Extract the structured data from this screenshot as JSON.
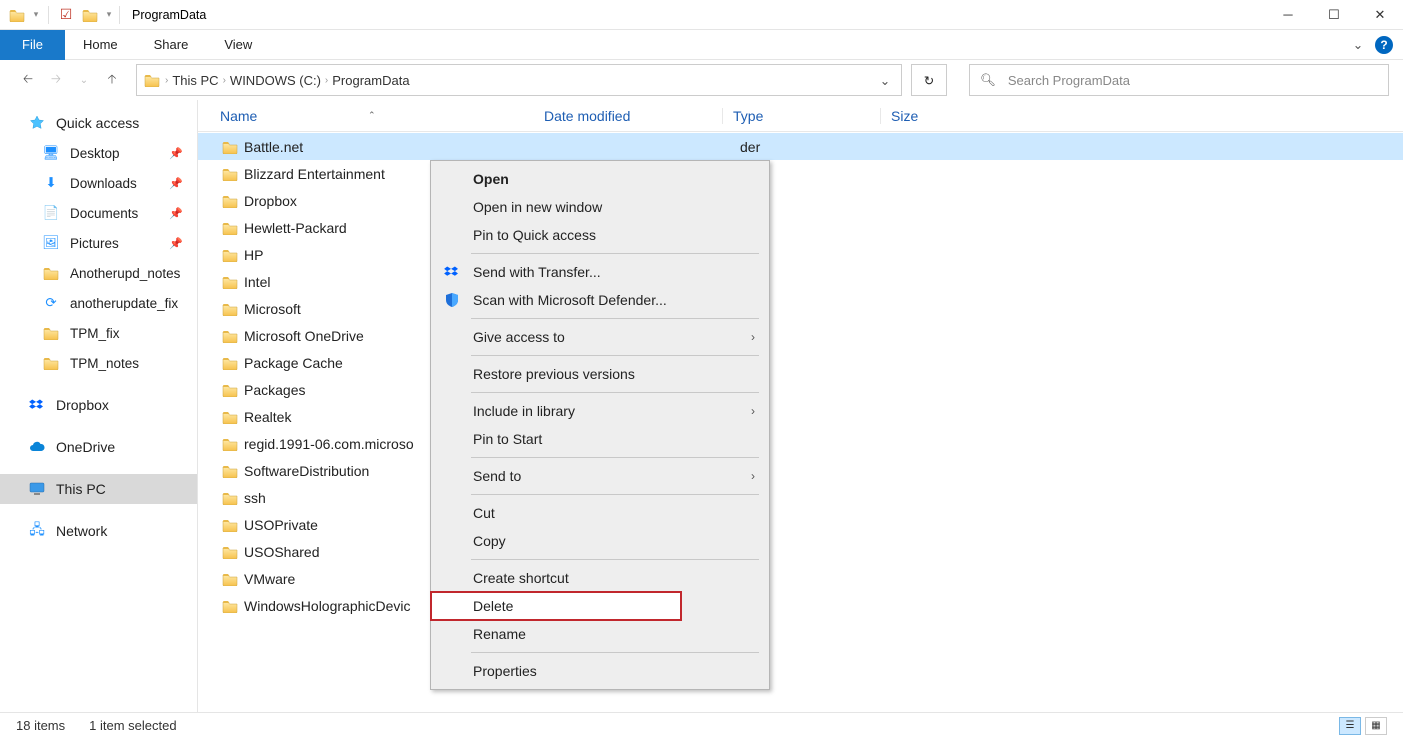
{
  "titlebar": {
    "title": "ProgramData"
  },
  "ribbon": {
    "tabs": {
      "file": "File",
      "home": "Home",
      "share": "Share",
      "view": "View"
    }
  },
  "breadcrumbs": {
    "pc": "This PC",
    "drive": "WINDOWS (C:)",
    "folder": "ProgramData"
  },
  "search": {
    "placeholder": "Search ProgramData"
  },
  "sidebar": {
    "quick": "Quick access",
    "desktop": "Desktop",
    "downloads": "Downloads",
    "documents": "Documents",
    "pictures": "Pictures",
    "anotherupd": "Anotherupd_notes",
    "anotherfix": "anotherupdate_fix",
    "tpmfix": "TPM_fix",
    "tpmnotes": "TPM_notes",
    "dropbox": "Dropbox",
    "onedrive": "OneDrive",
    "thispc": "This PC",
    "network": "Network"
  },
  "columns": {
    "name": "Name",
    "date": "Date modified",
    "type": "Type",
    "size": "Size"
  },
  "type_suffix": "der",
  "rows": {
    "battle": "Battle.net",
    "blizzard": "Blizzard Entertainment",
    "dropbox": "Dropbox",
    "hp1": "Hewlett-Packard",
    "hp2": "HP",
    "intel": "Intel",
    "ms": "Microsoft",
    "od": "Microsoft OneDrive",
    "pkgc": "Package Cache",
    "pkgs": "Packages",
    "realtek": "Realtek",
    "regid": "regid.1991-06.com.microso",
    "softd": "SoftwareDistribution",
    "ssh": "ssh",
    "usop": "USOPrivate",
    "usos": "USOShared",
    "vmw": "VMware",
    "whd": "WindowsHolographicDevic"
  },
  "ctx": {
    "open": "Open",
    "opennew": "Open in new window",
    "pinqa": "Pin to Quick access",
    "transfer": "Send with Transfer...",
    "defender": "Scan with Microsoft Defender...",
    "giveacc": "Give access to",
    "restore": "Restore previous versions",
    "inclib": "Include in library",
    "pinstart": "Pin to Start",
    "sendto": "Send to",
    "cut": "Cut",
    "copy": "Copy",
    "shortcut": "Create shortcut",
    "delete": "Delete",
    "rename": "Rename",
    "props": "Properties"
  },
  "status": {
    "count": "18 items",
    "sel": "1 item selected"
  }
}
